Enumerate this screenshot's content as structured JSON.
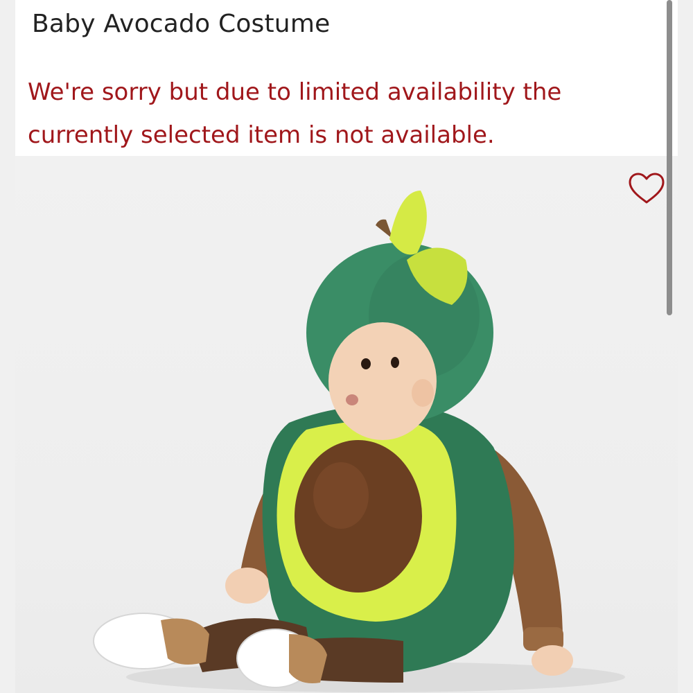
{
  "product": {
    "title": "Baby Avocado Costume",
    "availability_message": "We're sorry but due to limited availability the currently selected item is not available."
  },
  "favorite": {
    "icon": "heart-outline-icon",
    "color": "#a0171b"
  },
  "colors": {
    "error_text": "#a0171b",
    "title_text": "#222222"
  }
}
